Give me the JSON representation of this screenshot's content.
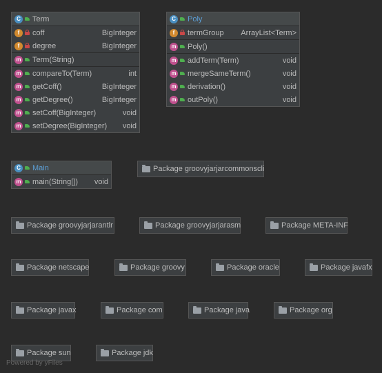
{
  "classes": {
    "term": {
      "name": "Term",
      "fields": [
        {
          "name": "coff",
          "type": "BigInteger"
        },
        {
          "name": "degree",
          "type": "BigInteger"
        }
      ],
      "constructors": [
        {
          "name": "Term(String)",
          "type": ""
        }
      ],
      "methods": [
        {
          "name": "compareTo(Term)",
          "type": "int"
        },
        {
          "name": "getCoff()",
          "type": "BigInteger"
        },
        {
          "name": "getDegree()",
          "type": "BigInteger"
        },
        {
          "name": "setCoff(BigInteger)",
          "type": "void"
        },
        {
          "name": "setDegree(BigInteger)",
          "type": "void"
        }
      ]
    },
    "poly": {
      "name": "Poly",
      "fields": [
        {
          "name": "termGroup",
          "type": "ArrayList<Term>"
        }
      ],
      "constructors": [
        {
          "name": "Poly()",
          "type": ""
        }
      ],
      "methods": [
        {
          "name": "addTerm(Term)",
          "type": "void"
        },
        {
          "name": "mergeSameTerm()",
          "type": "void"
        },
        {
          "name": "derivation()",
          "type": "void"
        },
        {
          "name": "outPoly()",
          "type": "void"
        }
      ]
    },
    "main": {
      "name": "Main",
      "methods": [
        {
          "name": "main(String[])",
          "type": "void"
        }
      ]
    }
  },
  "packages": [
    "Package groovyjarjarcommonscli",
    "Package groovyjarjarantlr",
    "Package groovyjarjarasm",
    "Package META-INF",
    "Package netscape",
    "Package groovy",
    "Package oracle",
    "Package javafx",
    "Package javax",
    "Package com",
    "Package java",
    "Package org",
    "Package sun",
    "Package jdk"
  ],
  "icons": {
    "class_badge": "C",
    "field_badge": "f",
    "method_badge": "m"
  },
  "footer": "Powered by yFiles"
}
